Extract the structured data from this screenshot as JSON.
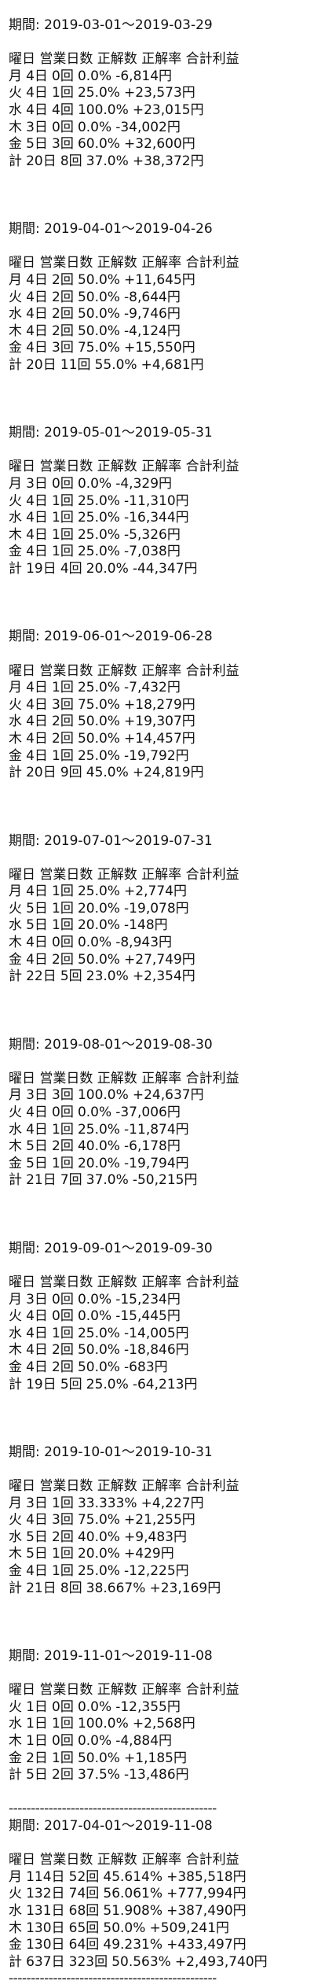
{
  "labels": {
    "period_prefix": "期間: ",
    "header": "曜日 営業日数 正解数 正解率 合計利益",
    "separator": "-----------------------------------------------"
  },
  "blocks": [
    {
      "period": "2019-03-01～2019-03-29",
      "rows": [
        [
          "月",
          "4日",
          "0回",
          "0.0%",
          "-6,814円"
        ],
        [
          "火",
          "4日",
          "1回",
          "25.0%",
          "+23,573円"
        ],
        [
          "水",
          "4日",
          "4回",
          "100.0%",
          "+23,015円"
        ],
        [
          "木",
          "3日",
          "0回",
          "0.0%",
          "-34,002円"
        ],
        [
          "金",
          "5日",
          "3回",
          "60.0%",
          "+32,600円"
        ],
        [
          "計",
          "20日",
          "8回",
          "37.0%",
          "+38,372円"
        ]
      ]
    },
    {
      "period": "2019-04-01～2019-04-26",
      "rows": [
        [
          "月",
          "4日",
          "2回",
          "50.0%",
          "+11,645円"
        ],
        [
          "火",
          "4日",
          "2回",
          "50.0%",
          "-8,644円"
        ],
        [
          "水",
          "4日",
          "2回",
          "50.0%",
          "-9,746円"
        ],
        [
          "木",
          "4日",
          "2回",
          "50.0%",
          "-4,124円"
        ],
        [
          "金",
          "4日",
          "3回",
          "75.0%",
          "+15,550円"
        ],
        [
          "計",
          "20日",
          "11回",
          "55.0%",
          "+4,681円"
        ]
      ]
    },
    {
      "period": "2019-05-01～2019-05-31",
      "rows": [
        [
          "月",
          "3日",
          "0回",
          "0.0%",
          "-4,329円"
        ],
        [
          "火",
          "4日",
          "1回",
          "25.0%",
          "-11,310円"
        ],
        [
          "水",
          "4日",
          "1回",
          "25.0%",
          "-16,344円"
        ],
        [
          "木",
          "4日",
          "1回",
          "25.0%",
          "-5,326円"
        ],
        [
          "金",
          "4日",
          "1回",
          "25.0%",
          "-7,038円"
        ],
        [
          "計",
          "19日",
          "4回",
          "20.0%",
          "-44,347円"
        ]
      ]
    },
    {
      "period": "2019-06-01～2019-06-28",
      "rows": [
        [
          "月",
          "4日",
          "1回",
          "25.0%",
          "-7,432円"
        ],
        [
          "火",
          "4日",
          "3回",
          "75.0%",
          "+18,279円"
        ],
        [
          "水",
          "4日",
          "2回",
          "50.0%",
          "+19,307円"
        ],
        [
          "木",
          "4日",
          "2回",
          "50.0%",
          "+14,457円"
        ],
        [
          "金",
          "4日",
          "1回",
          "25.0%",
          "-19,792円"
        ],
        [
          "計",
          "20日",
          "9回",
          "45.0%",
          "+24,819円"
        ]
      ]
    },
    {
      "period": "2019-07-01～2019-07-31",
      "rows": [
        [
          "月",
          "4日",
          "1回",
          "25.0%",
          "+2,774円"
        ],
        [
          "火",
          "5日",
          "1回",
          "20.0%",
          "-19,078円"
        ],
        [
          "水",
          "5日",
          "1回",
          "20.0%",
          "-148円"
        ],
        [
          "木",
          "4日",
          "0回",
          "0.0%",
          "-8,943円"
        ],
        [
          "金",
          "4日",
          "2回",
          "50.0%",
          "+27,749円"
        ],
        [
          "計",
          "22日",
          "5回",
          "23.0%",
          "+2,354円"
        ]
      ]
    },
    {
      "period": "2019-08-01～2019-08-30",
      "rows": [
        [
          "月",
          "3日",
          "3回",
          "100.0%",
          "+24,637円"
        ],
        [
          "火",
          "4日",
          "0回",
          "0.0%",
          "-37,006円"
        ],
        [
          "水",
          "4日",
          "1回",
          "25.0%",
          "-11,874円"
        ],
        [
          "木",
          "5日",
          "2回",
          "40.0%",
          "-6,178円"
        ],
        [
          "金",
          "5日",
          "1回",
          "20.0%",
          "-19,794円"
        ],
        [
          "計",
          "21日",
          "7回",
          "37.0%",
          "-50,215円"
        ]
      ]
    },
    {
      "period": "2019-09-01～2019-09-30",
      "rows": [
        [
          "月",
          "3日",
          "0回",
          "0.0%",
          "-15,234円"
        ],
        [
          "火",
          "4日",
          "0回",
          "0.0%",
          "-15,445円"
        ],
        [
          "水",
          "4日",
          "1回",
          "25.0%",
          "-14,005円"
        ],
        [
          "木",
          "4日",
          "2回",
          "50.0%",
          "-18,846円"
        ],
        [
          "金",
          "4日",
          "2回",
          "50.0%",
          "-683円"
        ],
        [
          "計",
          "19日",
          "5回",
          "25.0%",
          "-64,213円"
        ]
      ]
    },
    {
      "period": "2019-10-01～2019-10-31",
      "rows": [
        [
          "月",
          "3日",
          "1回",
          "33.333%",
          "+4,227円"
        ],
        [
          "火",
          "4日",
          "3回",
          "75.0%",
          "+21,255円"
        ],
        [
          "水",
          "5日",
          "2回",
          "40.0%",
          "+9,483円"
        ],
        [
          "木",
          "5日",
          "1回",
          "20.0%",
          "+429円"
        ],
        [
          "金",
          "4日",
          "1回",
          "25.0%",
          "-12,225円"
        ],
        [
          "計",
          "21日",
          "8回",
          "38.667%",
          "+23,169円"
        ]
      ]
    },
    {
      "period": "2019-11-01～2019-11-08",
      "rows": [
        [
          "火",
          "1日",
          "0回",
          "0.0%",
          "-12,355円"
        ],
        [
          "水",
          "1日",
          "1回",
          "100.0%",
          "+2,568円"
        ],
        [
          "木",
          "1日",
          "0回",
          "0.0%",
          "-4,884円"
        ],
        [
          "金",
          "2日",
          "1回",
          "50.0%",
          "+1,185円"
        ],
        [
          "計",
          "5日",
          "2回",
          "37.5%",
          "-13,486円"
        ]
      ]
    }
  ],
  "summary": {
    "period": "2017-04-01～2019-11-08",
    "rows": [
      [
        "月",
        "114日",
        "52回",
        "45.614%",
        "+385,518円"
      ],
      [
        "火",
        "132日",
        "74回",
        "56.061%",
        "+777,994円"
      ],
      [
        "水",
        "131日",
        "68回",
        "51.908%",
        "+387,490円"
      ],
      [
        "木",
        "130日",
        "65回",
        "50.0%",
        "+509,241円"
      ],
      [
        "金",
        "130日",
        "64回",
        "49.231%",
        "+433,497円"
      ],
      [
        "計",
        "637日",
        "323回",
        "50.563%",
        "+2,493,740円"
      ]
    ]
  }
}
